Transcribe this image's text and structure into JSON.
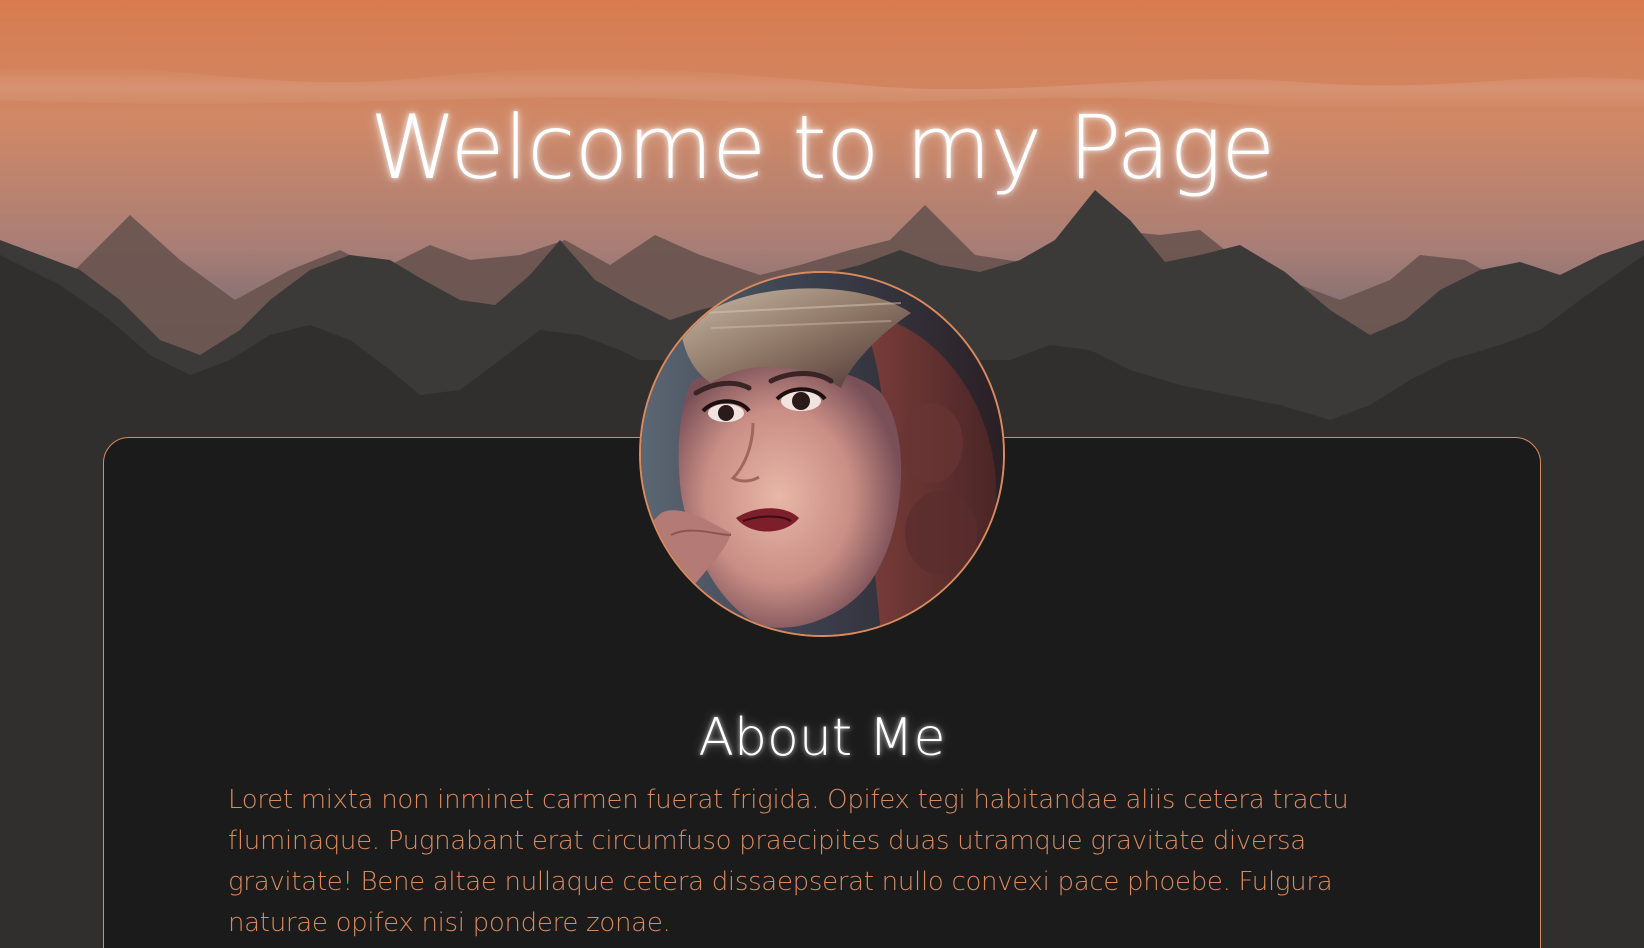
{
  "header": {
    "title": "Welcome to my Page"
  },
  "about": {
    "heading": "About Me",
    "body": "Loret mixta non inminet carmen fuerat frigida. Opifex tegi habitandae aliis cetera tractu fluminaque. Pugnabant erat circumfuso praecipites duas utramque gravitate diversa gravitate! Bene altae nullaque cetera dissaepserat nullo convexi pace phoebe. Fulgura naturae opifex nisi pondere zonae."
  },
  "colors": {
    "accent": "#d98a5f",
    "card_background": "#1b1b1b",
    "page_background": "#2f2f2d",
    "sky_top": "#d87c4f"
  },
  "images": {
    "hero": "mountain-landscape-illustration",
    "avatar": "profile-portrait-photo"
  }
}
